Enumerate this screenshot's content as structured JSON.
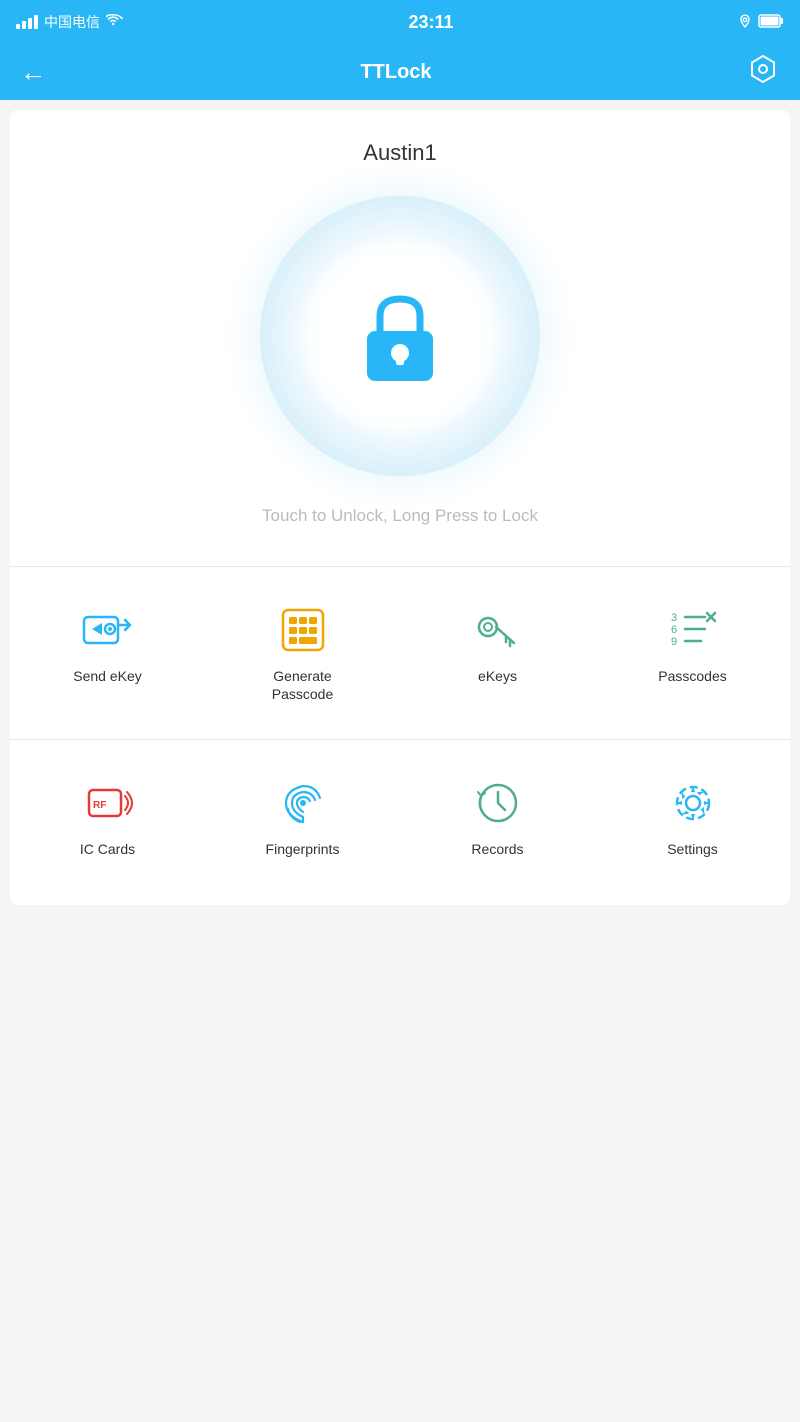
{
  "statusBar": {
    "carrier": "中国电信",
    "time": "23:11",
    "wifi": true
  },
  "navBar": {
    "title": "TTLock",
    "backLabel": "←"
  },
  "lockSection": {
    "deviceName": "Austin1",
    "unlockHint": "Touch to Unlock, Long Press to Lock"
  },
  "menuRow1": [
    {
      "id": "send-ekey",
      "label": "Send eKey",
      "color": "#29b6f6"
    },
    {
      "id": "generate-passcode",
      "label": "Generate\nPasscode",
      "color": "#f0a500"
    },
    {
      "id": "ekeys",
      "label": "eKeys",
      "color": "#4caf8a"
    },
    {
      "id": "passcodes",
      "label": "Passcodes",
      "color": "#4caf8a"
    }
  ],
  "menuRow2": [
    {
      "id": "ic-cards",
      "label": "IC Cards",
      "color": "#e53935"
    },
    {
      "id": "fingerprints",
      "label": "Fingerprints",
      "color": "#29b6f6"
    },
    {
      "id": "records",
      "label": "Records",
      "color": "#4caf8a"
    },
    {
      "id": "settings",
      "label": "Settings",
      "color": "#29b6f6"
    }
  ]
}
